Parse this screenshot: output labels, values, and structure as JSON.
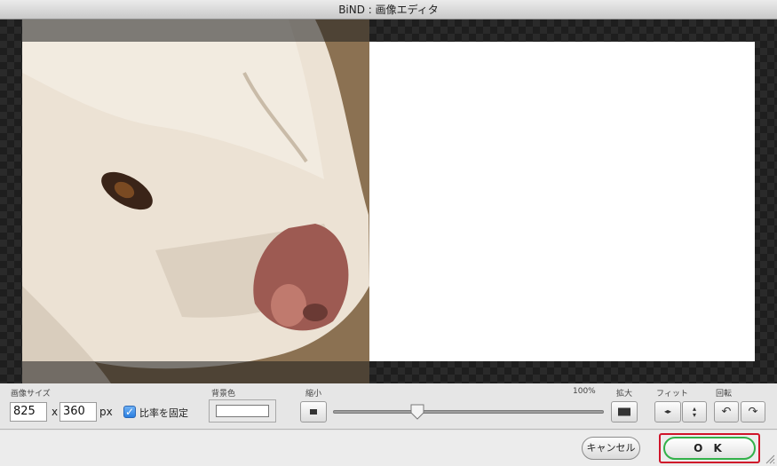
{
  "window": {
    "title": "BiND : 画像エディタ"
  },
  "image_size": {
    "label": "画像サイズ",
    "width": "825",
    "separator": "x",
    "height": "360",
    "unit": "px"
  },
  "keep_ratio": {
    "label": "比率を固定",
    "checked": true
  },
  "background_color": {
    "label": "背景色",
    "value": "#ffffff"
  },
  "zoom": {
    "shrink_label": "縮小",
    "enlarge_label": "拡大",
    "percent_text": "100%",
    "slider_level": 0.31
  },
  "fit": {
    "label": "フィット"
  },
  "rotate": {
    "label": "回転"
  },
  "footer": {
    "cancel_label": "キャンセル",
    "ok_label": "O K"
  },
  "colors": {
    "ok_highlight": "#d0142a",
    "ok_ring": "#33b14a",
    "checkbox": "#2a7ee0"
  }
}
